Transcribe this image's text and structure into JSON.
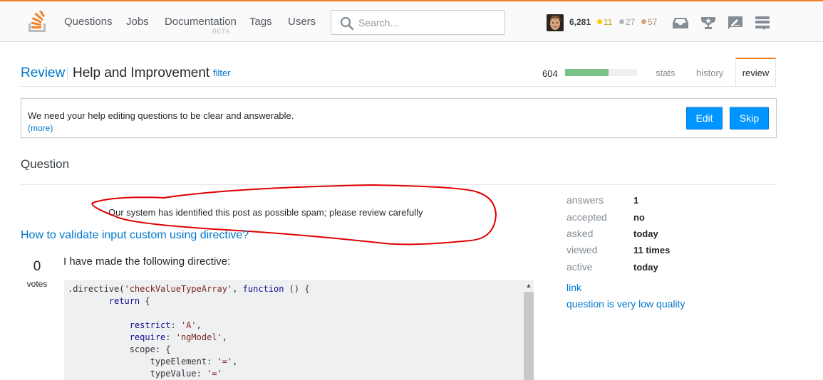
{
  "topbar": {
    "logo": "stack-overflow-logo",
    "nav": [
      {
        "label": "Questions"
      },
      {
        "label": "Jobs"
      },
      {
        "label": "Documentation",
        "sub": "BETA"
      },
      {
        "label": "Tags"
      },
      {
        "label": "Users"
      }
    ],
    "search": {
      "placeholder": "Search...",
      "value": ""
    },
    "user": {
      "reputation": "6,281",
      "badges": {
        "gold": {
          "count": "11",
          "color": "#ffcc01"
        },
        "silver": {
          "count": "27",
          "color": "#b4b8bc"
        },
        "bronze": {
          "count": "57",
          "color": "#d1a684"
        }
      }
    },
    "icons": [
      "inbox-icon",
      "achievements-icon",
      "review-icon",
      "help-menu-icon"
    ]
  },
  "header": {
    "breadcrumb_root": "Review",
    "title": "Help and Improvement",
    "filter_label": "filter",
    "queue_count": "604",
    "queue_progress_percent": 60,
    "tabs": [
      {
        "label": "stats",
        "active": false
      },
      {
        "label": "history",
        "active": false
      },
      {
        "label": "review",
        "active": true
      }
    ]
  },
  "info": {
    "text": "We need your help editing questions to be clear and answerable.",
    "more": "(more)",
    "edit_label": "Edit",
    "skip_label": "Skip"
  },
  "question": {
    "section_title": "Question",
    "spam_notice": "Our system has identified this post as possible spam; please review carefully",
    "title": "How to validate input custom using directive?",
    "votes": "0",
    "votes_label": "votes",
    "body_intro": "I have made the following directive:",
    "code_lines": [
      [
        {
          "t": ".directive(",
          "c": ""
        },
        {
          "t": "'checkValueTypeArray'",
          "c": "str"
        },
        {
          "t": ", ",
          "c": ""
        },
        {
          "t": "function",
          "c": "kw"
        },
        {
          "t": " () {",
          "c": ""
        }
      ],
      [
        {
          "t": "        ",
          "c": ""
        },
        {
          "t": "return",
          "c": "kw"
        },
        {
          "t": " {",
          "c": ""
        }
      ],
      [
        {
          "t": "",
          "c": ""
        }
      ],
      [
        {
          "t": "            ",
          "c": ""
        },
        {
          "t": "restrict",
          "c": "kw"
        },
        {
          "t": ": ",
          "c": ""
        },
        {
          "t": "'A'",
          "c": "str"
        },
        {
          "t": ",",
          "c": ""
        }
      ],
      [
        {
          "t": "            ",
          "c": ""
        },
        {
          "t": "require",
          "c": "kw"
        },
        {
          "t": ": ",
          "c": ""
        },
        {
          "t": "'ngModel'",
          "c": "str"
        },
        {
          "t": ",",
          "c": ""
        }
      ],
      [
        {
          "t": "            scope: {",
          "c": ""
        }
      ],
      [
        {
          "t": "                typeElement: ",
          "c": ""
        },
        {
          "t": "'='",
          "c": "str"
        },
        {
          "t": ",",
          "c": ""
        }
      ],
      [
        {
          "t": "                typeValue: ",
          "c": ""
        },
        {
          "t": "'='",
          "c": "str"
        }
      ]
    ]
  },
  "sidebar": {
    "stats": [
      {
        "label": "answers",
        "value": "1"
      },
      {
        "label": "accepted",
        "value": "no"
      },
      {
        "label": "asked",
        "value": "today"
      },
      {
        "label": "viewed",
        "value": "11 times"
      },
      {
        "label": "active",
        "value": "today"
      }
    ],
    "links": [
      {
        "label": "link"
      },
      {
        "label": "question is very low quality"
      }
    ]
  },
  "annotation": {
    "color": "#e00000"
  }
}
